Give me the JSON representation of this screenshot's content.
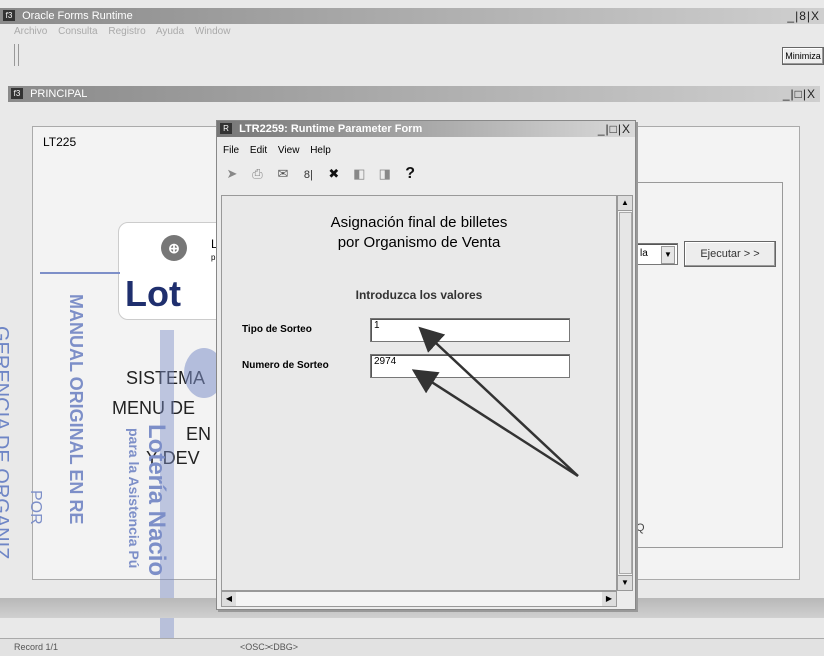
{
  "app": {
    "title": "Oracle Forms Runtime",
    "menu": [
      "Archivo",
      "Consulta",
      "Registro",
      "Ayuda",
      "Window"
    ],
    "window_buttons": "_|8|X",
    "minimize_label": "Minimiza"
  },
  "principal": {
    "title": "PRINCIPAL",
    "window_buttons": "_|□|X",
    "form_code": "LT225",
    "logo_small_text_1": "L",
    "logo_small_text_2": "p",
    "logo_big_text": "Lot",
    "menu_lines": [
      "SISTEMA",
      "MENU DE",
      "EN",
      "Y DEV"
    ],
    "dropdown_value": "la",
    "execute_button": "Ejecutar > >",
    "right_letter": "Q"
  },
  "dialog": {
    "title": "LTR2259: Runtime Parameter Form",
    "window_buttons": "_|□|X",
    "menu": [
      "File",
      "Edit",
      "View",
      "Help"
    ],
    "toolbar_icons": [
      "run-icon",
      "print-icon",
      "mail-icon",
      "help-query-icon",
      "close-x-icon",
      "first-page-icon",
      "last-page-icon",
      "help-icon"
    ],
    "toolbar_glyphs": [
      "➤",
      "⎙",
      "✉",
      "8|",
      "✖",
      "◧",
      "◨",
      "?"
    ],
    "heading_line1": "Asignación final de billetes",
    "heading_line2": "por Organismo de Venta",
    "instruction": "Introduzca los valores",
    "fields": [
      {
        "label": "Tipo de Sorteo",
        "value": "1"
      },
      {
        "label": "Numero de Sorteo",
        "value": "2974"
      }
    ]
  },
  "status": {
    "record": "Record 1/1",
    "osc": "<OSC>",
    "dbg": "<DBG>"
  },
  "stamps": {
    "manual": "MANUAL ORIGINAL EN RE",
    "gerencia": "GERENCIA DE ORGANIZ",
    "por": "POR",
    "loteria": "Lotería Nacio",
    "asistencia": "para la Asistencia Pú"
  }
}
